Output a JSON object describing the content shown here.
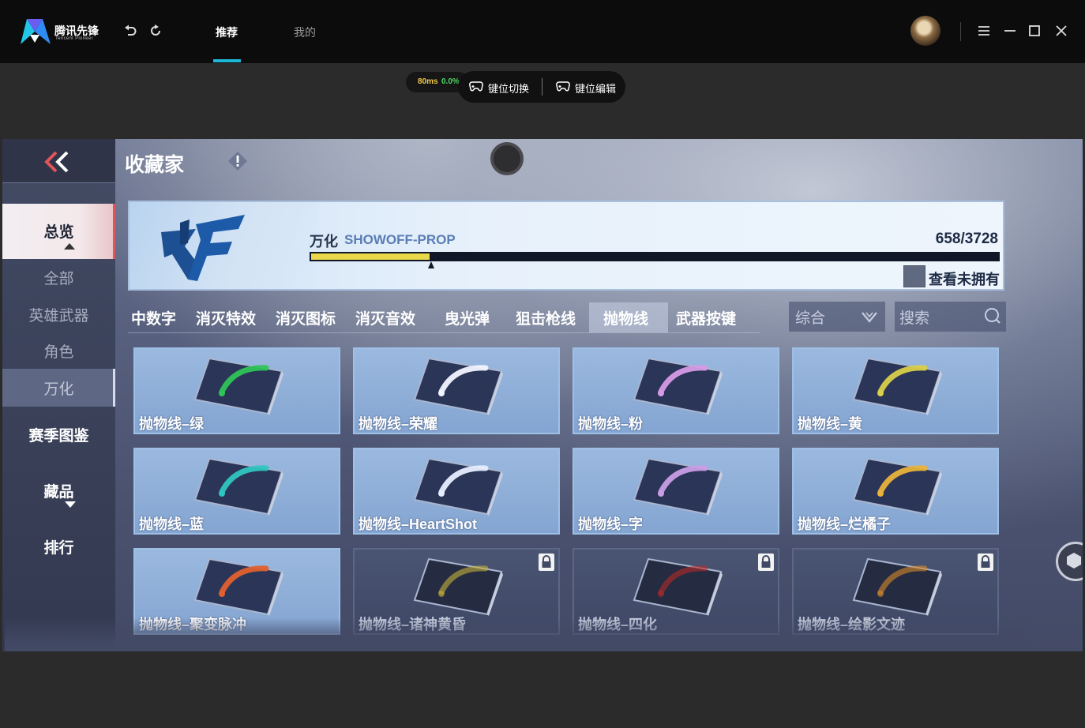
{
  "app": {
    "name": "腾讯先锋",
    "name_sub": "Tencent Pioneer",
    "nav_tabs": [
      {
        "label": "推荐",
        "active": true
      },
      {
        "label": "我的",
        "active": false
      }
    ]
  },
  "toolbar": {
    "latency": "80ms",
    "packet_loss": "0.0%",
    "key_switch": "键位切换",
    "key_edit": "键位编辑"
  },
  "game": {
    "page_title": "收藏家",
    "sidebar": [
      {
        "label": "总览",
        "style": "active"
      },
      {
        "label": "全部",
        "style": "dim"
      },
      {
        "label": "英雄武器",
        "style": "dim"
      },
      {
        "label": "角色",
        "style": "dim"
      },
      {
        "label": "万化",
        "style": "dim-selected"
      },
      {
        "label": "赛季图鉴",
        "style": "normal"
      },
      {
        "label": "藏品",
        "style": "normal"
      },
      {
        "label": "排行",
        "style": "normal"
      }
    ],
    "banner": {
      "name_cn": "万化",
      "name_en": "SHOWOFF-PROP",
      "count": "658/3728",
      "progress": 0.1765,
      "own_label": "查看未拥有"
    },
    "tabs": [
      "中数字",
      "消灭特效",
      "消灭图标",
      "消灭音效",
      "曳光弹",
      "狙击枪线",
      "抛物线",
      "武器按键"
    ],
    "active_tab": "抛物线",
    "sort_label": "综合",
    "search_placeholder": "搜索",
    "items": [
      {
        "label": "抛物线–绿",
        "color": "#2fc458",
        "locked": false
      },
      {
        "label": "抛物线–荣耀",
        "color": "#f2f6ff",
        "locked": false
      },
      {
        "label": "抛物线–粉",
        "color": "#d59be6",
        "locked": false
      },
      {
        "label": "抛物线–黄",
        "color": "#d8cf4a",
        "locked": false
      },
      {
        "label": "抛物线–蓝",
        "color": "#2fc6c0",
        "locked": false
      },
      {
        "label": "抛物线–HeartShot",
        "color": "#e6eeff",
        "locked": false
      },
      {
        "label": "抛物线–字",
        "color": "#c99ee6",
        "locked": false
      },
      {
        "label": "抛物线–烂橘子",
        "color": "#e8b23c",
        "locked": false
      },
      {
        "label": "抛物线–聚变脉冲",
        "color": "#e0612e",
        "locked": false
      },
      {
        "label": "抛物线–诸神黄昏",
        "color": "#c4b03a",
        "locked": true
      },
      {
        "label": "抛物线–四化",
        "color": "#b82a2a",
        "locked": true
      },
      {
        "label": "抛物线–绘影文迹",
        "color": "#d88a2a",
        "locked": true
      }
    ]
  }
}
